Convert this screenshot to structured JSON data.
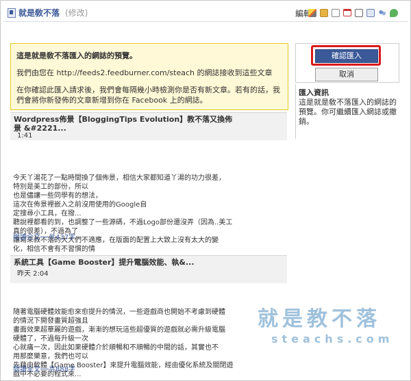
{
  "header": {
    "title": "就是敎不落",
    "edit_link": "(修改)",
    "edit_label": "編輯",
    "tool_icons": [
      "pencil-icon",
      "folder-icon",
      "doc-icon",
      "calendar-icon",
      "box-icon",
      "grid-icon",
      "people-icon",
      "bubble-icon"
    ]
  },
  "notice": {
    "title": "這是就是敎不落匯入的網誌的預覽。",
    "line1": "我們由您在 http://feeds2.feedburner.com/steach 的網誌接收到這些文章",
    "line2": "在你確認此匯入請求後，我們會每隔幾小時檢測你是否有新文章。若有的話，我們會將你新發佈的文章新增到你在 Facebook 上的網誌。"
  },
  "actions": {
    "confirm": "確認匯入",
    "cancel": "取消"
  },
  "side_info": {
    "heading": "匯入資訊",
    "text": "這是就是敎不落匯入的網誌的預覽。你可繼續匯入網誌或撤銷。"
  },
  "posts": [
    {
      "title": "Wordpress佈景【BloggingTips Evolution】教不落又換佈景 &#2221...",
      "time": "1:41",
      "lines": [
        "今天丫湯花了一點時間換了個佈景，相信大家都知道丫湯的功力很差，",
        "特別是美工的部份，所以",
        "也是儘讓一些同學有的想法，",
        "這次在佈景裡嵌入之前沒用使用的Google自",
        "定搜尋小工具，在撥...",
        "聽說裡都看的到，也調整了一些源碼，不過Logo部份還沒弄（因為..美工",
        "真的很差），不過為了",
        "讓寫來教不落的大大們不適應，在版面的配置上大致上沒有太大的變",
        "化，相信不會有不習慣的情"
      ],
      "more": "閱讀全文──共437字"
    },
    {
      "title": "系統工具【Game Booster】提升電腦效能、執&...",
      "time": "昨天 2:04",
      "lines": [
        "隨著電腦硬體效能愈來愈提升的情況，一些遊戲商也開始不考慮到硬體",
        "的情況下開發畫質超強且",
        "畫面效果超華麗的遊戲，漸漸的想玩這些超優質的遊戲就必需升級電腦",
        "硬體了，不過每升級一次",
        "心就痛一次，因此如果硬體介於順暢和不順暢的中間的話，其實也不",
        "用那麼樂意，我們也可以",
        "先藉由軟體【Game Booster】來提升電腦效能，經由優化系統及關閉遊",
        "戲中不必要的程式來..."
      ],
      "more": "閱讀全文──共888字"
    }
  ],
  "watermark": {
    "text1": "就是教不落",
    "text2": "steachs.com"
  },
  "colors": {
    "accent": "#3b5998",
    "notice_bg": "#fff9d7",
    "highlight": "#d8191a"
  }
}
